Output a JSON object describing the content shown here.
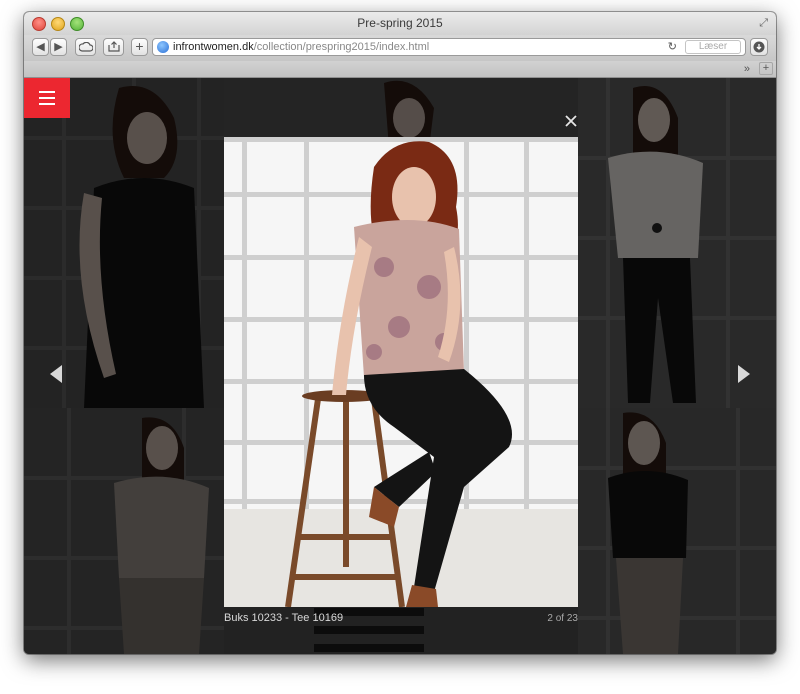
{
  "window": {
    "title": "Pre-spring 2015"
  },
  "address_bar": {
    "domain": "infrontwomen.dk",
    "path": "/collection/prespring2015/index.html",
    "reader_label": "Læser"
  },
  "lightbox": {
    "caption": "Buks 10233 - Tee 10169",
    "counter": "2 of 23"
  },
  "colors": {
    "menu_accent": "#ec2730",
    "overlay": "#000000"
  },
  "icons": {
    "menu": "hamburger-icon",
    "close": "close-icon",
    "previous": "arrow-left-icon",
    "next": "arrow-right-icon"
  }
}
